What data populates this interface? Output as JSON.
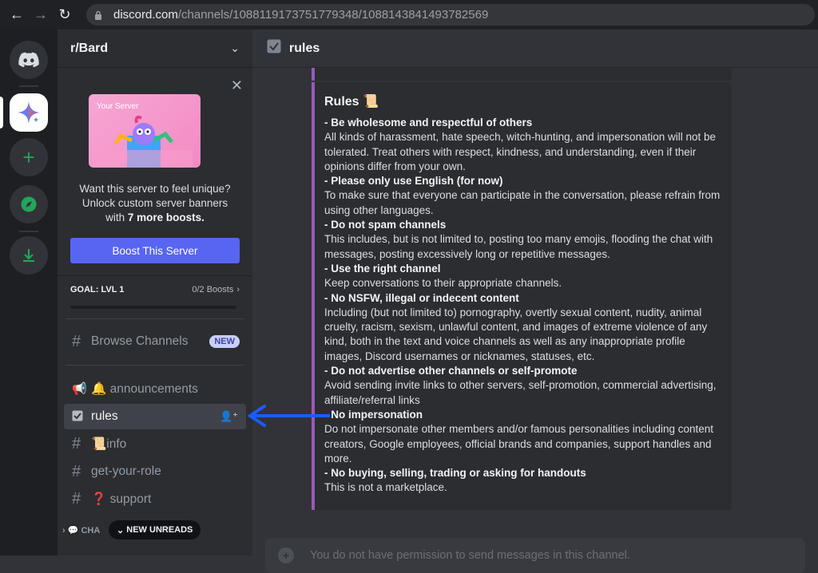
{
  "browser": {
    "url_host": "discord.com",
    "url_path": "/channels/1088119173751779348/1088143841493782569"
  },
  "server": {
    "name": "r/Bard"
  },
  "boost": {
    "banner_title": "Your Server",
    "text_line1": "Want this server to feel unique?",
    "text_line2": "Unlock custom server banners",
    "text_line3_pre": "with ",
    "text_line3_bold": "7 more boosts.",
    "button": "Boost This Server",
    "goal_label": "GOAL: LVL 1",
    "goal_count": "0/2 Boosts",
    "progress": 0
  },
  "channels": {
    "browse": "Browse Channels",
    "browse_badge": "NEW",
    "announcements": "🔔 announcements",
    "rules": "rules",
    "info": "📜info",
    "get_role": "get-your-role",
    "support": "❓ support",
    "chat_category": "CHA",
    "new_unreads": "NEW UNREADS"
  },
  "main": {
    "channel_title": "rules",
    "embed_title": "Rules 📜",
    "rules": [
      {
        "head": "- Be wholesome and respectful of others",
        "body": "All kinds of harassment, hate speech, witch-hunting, and impersonation will not be tolerated. Treat others with respect, kindness, and understanding, even if their opinions differ from your own."
      },
      {
        "head": "- Please only use English (for now)",
        "body": "To make sure that everyone can participate in the conversation, please refrain from using other languages."
      },
      {
        "head": "- Do not spam channels",
        "body": "This includes, but is not limited to, posting too many emojis, flooding the chat with messages, posting excessively long or repetitive messages."
      },
      {
        "head": "- Use the right channel",
        "body": "Keep conversations to their appropriate channels."
      },
      {
        "head": "- No NSFW, illegal or indecent content",
        "body": "Including (but not limited to) pornography, overtly sexual content, nudity, animal cruelty, racism, sexism, unlawful content, and images of extreme violence of any kind, both in the text and voice channels as well as any inappropriate profile images, Discord usernames or nicknames, statuses, etc."
      },
      {
        "head": "- Do not advertise other channels or self-promote",
        "body": "Avoid sending invite links to other servers, self-promotion, commercial advertising, affiliate/referral links"
      },
      {
        "head": "- No impersonation",
        "body": "Do not impersonate other members and/or famous personalities including content creators, Google employees, official brands and companies, support handles and more."
      },
      {
        "head": "- No buying, selling, trading or asking for handouts",
        "body": "This is not a marketplace."
      }
    ],
    "composer_placeholder": "You do not have permission to send messages in this channel."
  },
  "colors": {
    "blurple": "#5865f2",
    "embed_accent": "#9b59b6",
    "annotation_arrow": "#1a5cff"
  }
}
